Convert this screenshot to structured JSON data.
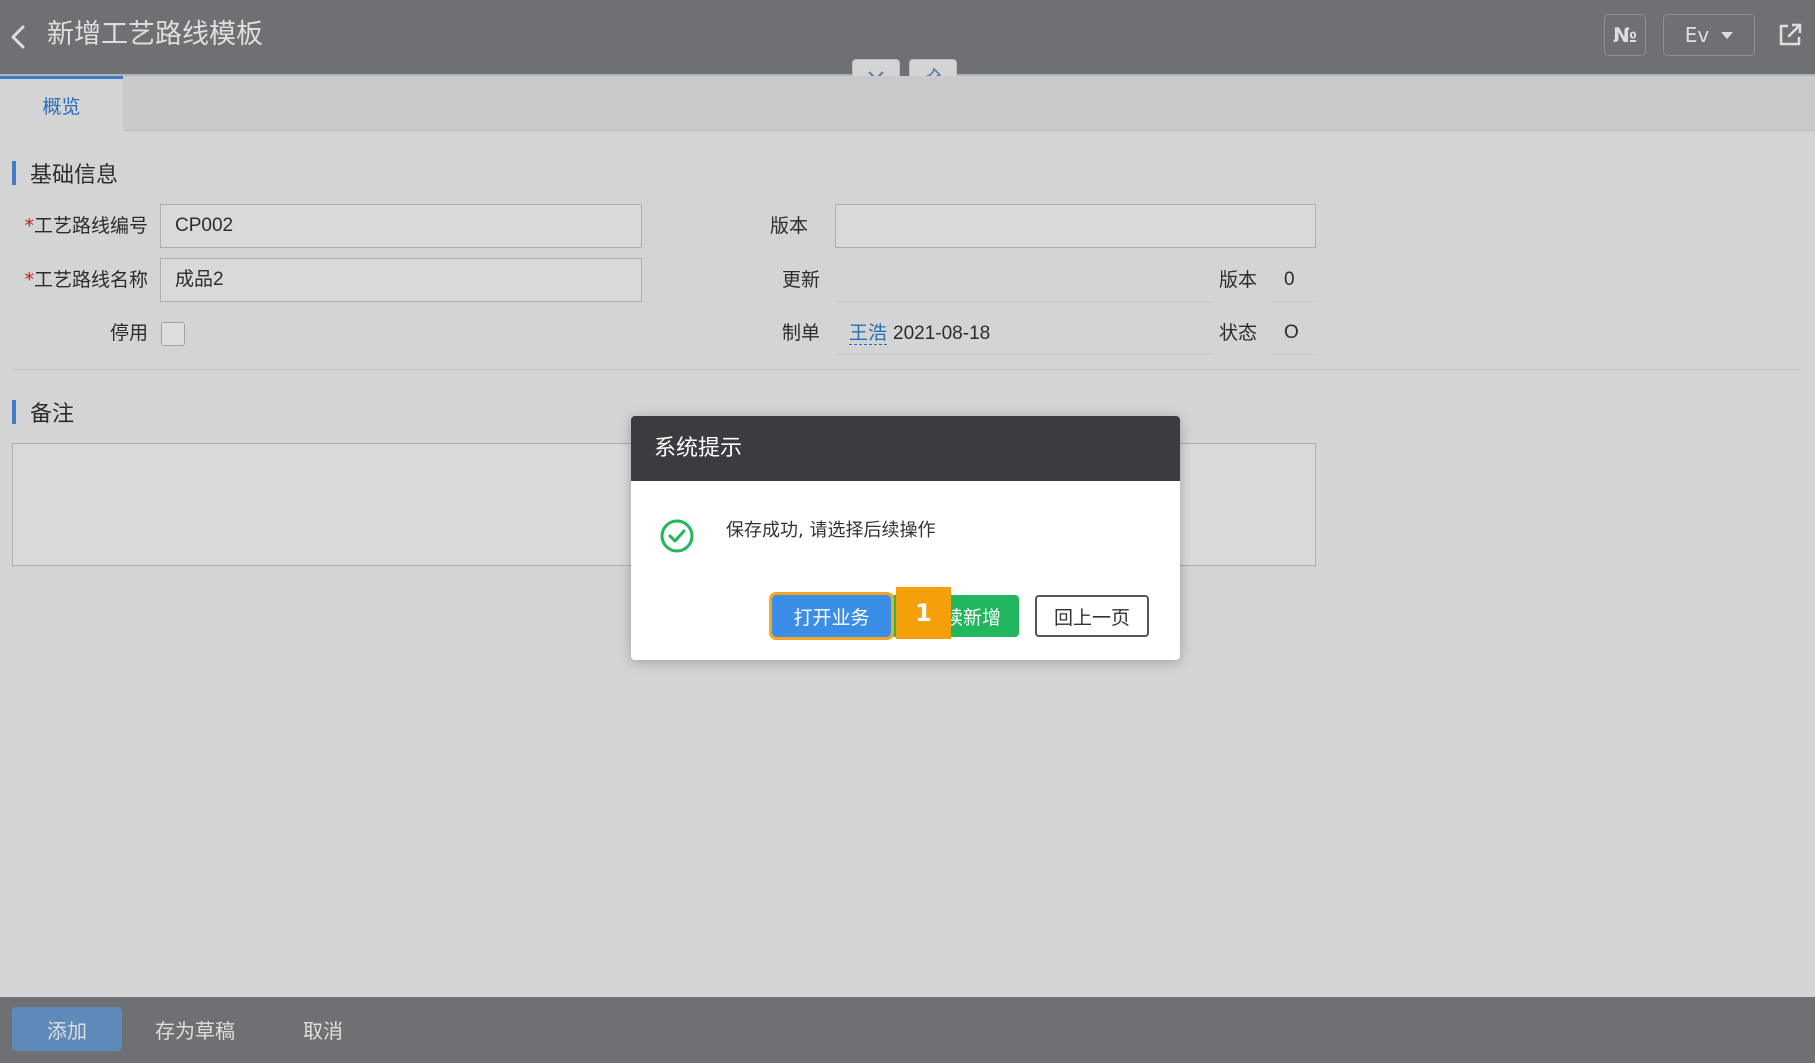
{
  "header": {
    "title": "新增工艺路线模板",
    "no_label": "№",
    "lang_label": "Ev"
  },
  "tabs": [
    {
      "label": "概览"
    }
  ],
  "basic_section": {
    "title": "基础信息",
    "route_code_label": "工艺路线编号",
    "route_code_value": "CP002",
    "route_name_label": "工艺路线名称",
    "route_name_value": "成品2",
    "disabled_label": "停用",
    "version_label": "版本",
    "version_value": "",
    "update_label": "更新",
    "version2_label": "版本",
    "version2_value": "0",
    "creator_label": "制单",
    "creator_name": "王浩",
    "creator_date": "2021-08-18",
    "status_label": "状态",
    "status_value": "O"
  },
  "notes_section": {
    "title": "备注"
  },
  "footer": {
    "add_label": "添加",
    "draft_label": "存为草稿",
    "cancel_label": "取消"
  },
  "dialog": {
    "title": "系统提示",
    "message": "保存成功, 请选择后续操作",
    "open_label": "打开业务",
    "continue_label": "续新增",
    "back_label": "回上一页"
  },
  "marker": {
    "label": "1"
  },
  "colors": {
    "header_bg": "#7f8185",
    "accent": "#4a90e2",
    "success": "#20b75e",
    "dialog_head": "#3a3c40",
    "highlight": "#f5a623"
  }
}
